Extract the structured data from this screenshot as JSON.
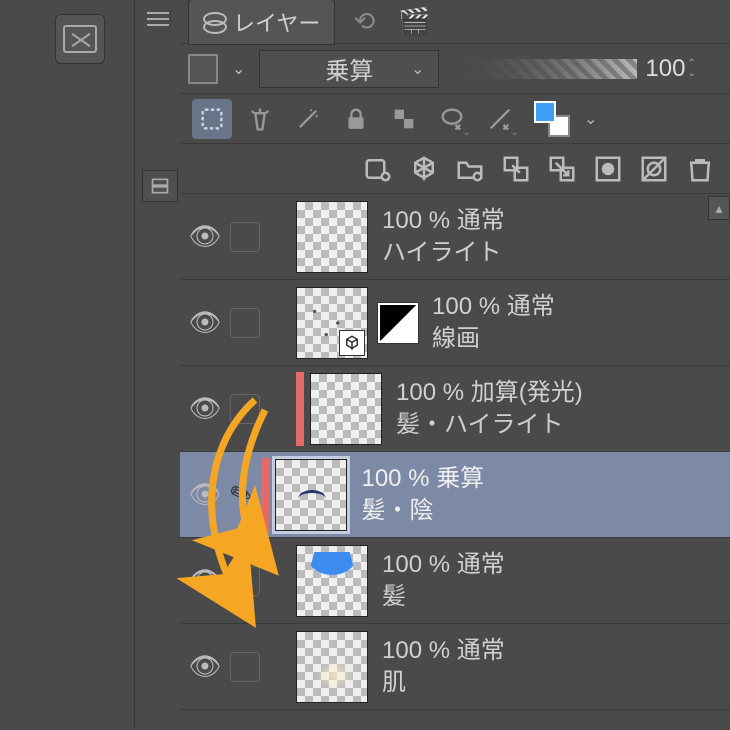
{
  "tab": {
    "label": "レイヤー"
  },
  "blend": {
    "mode": "乗算",
    "opacity": "100"
  },
  "fg_color": "#3da0f5",
  "bg_color": "#ffffff",
  "layers": [
    {
      "opacity_mode": "100 % 通常",
      "name": "ハイライト",
      "clip": false,
      "selected": false,
      "type": "raster",
      "art": "none"
    },
    {
      "opacity_mode": "100 % 通常",
      "name": "線画",
      "clip": false,
      "selected": false,
      "type": "3d",
      "art": "scribble"
    },
    {
      "opacity_mode": "100 % 加算(発光)",
      "name": "髪・ハイライト",
      "clip": true,
      "selected": false,
      "type": "raster",
      "art": "none"
    },
    {
      "opacity_mode": "100 % 乗算",
      "name": "髪・陰",
      "clip": true,
      "selected": true,
      "type": "raster",
      "art": "hair-dark"
    },
    {
      "opacity_mode": "100 % 通常",
      "name": "髪",
      "clip": false,
      "selected": false,
      "type": "raster",
      "art": "hair-blue"
    },
    {
      "opacity_mode": "100 % 通常",
      "name": "肌",
      "clip": false,
      "selected": false,
      "type": "raster",
      "art": "skin"
    }
  ]
}
